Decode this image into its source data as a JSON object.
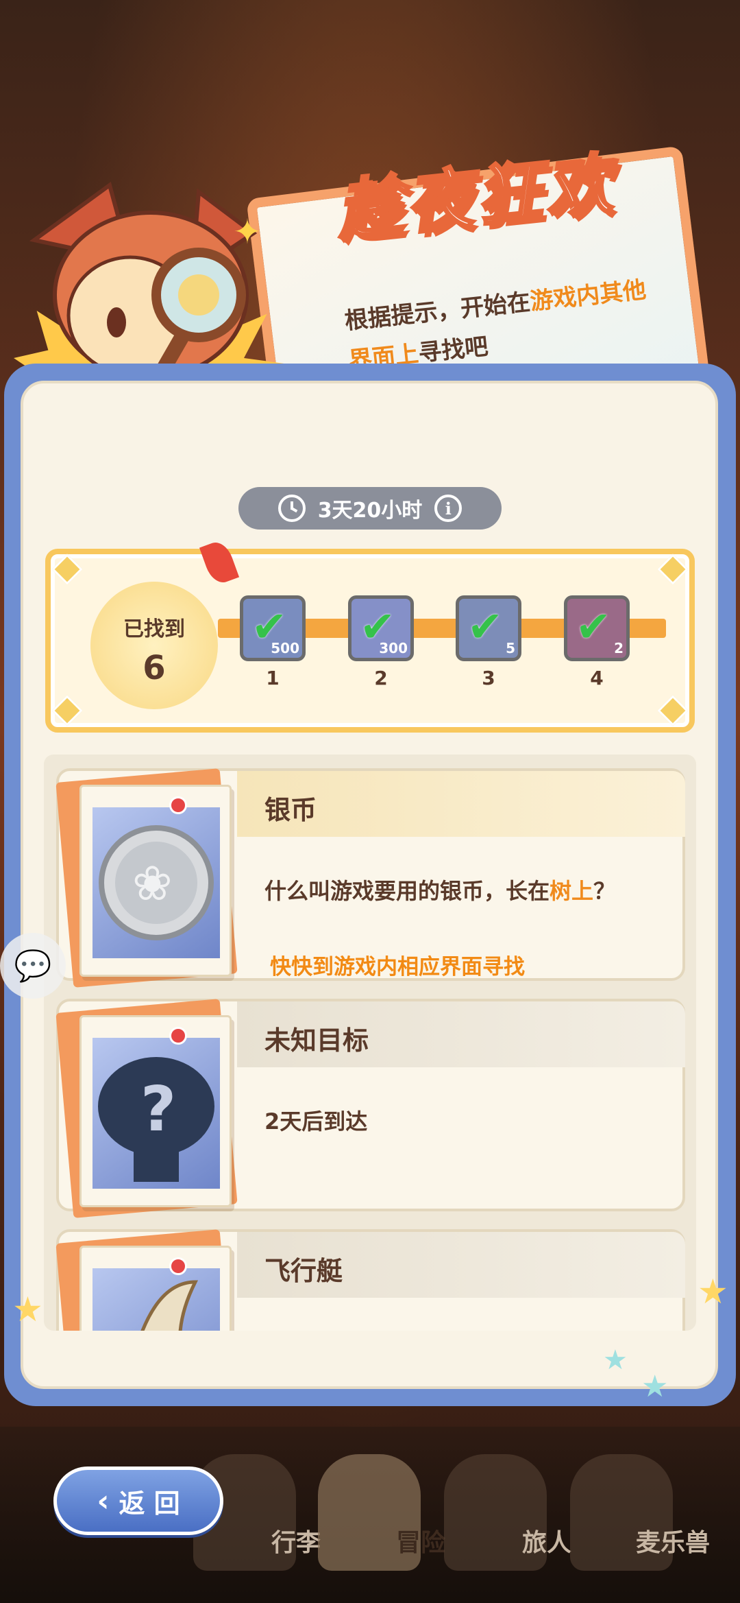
{
  "event": {
    "title": "趁夜狂欢",
    "subtitle_plain": "根据提示，开始在",
    "subtitle_highlight1": "游戏内其他界面上",
    "subtitle_end": "寻找吧"
  },
  "timer": {
    "text": "3天20小时",
    "icon": "clock-icon",
    "info_icon": "info-icon"
  },
  "progress": {
    "found_label": "已找到",
    "found_count": "6",
    "milestones": [
      {
        "index": "1",
        "count": "500",
        "claimed": true
      },
      {
        "index": "2",
        "count": "300",
        "claimed": true
      },
      {
        "index": "3",
        "count": "5",
        "claimed": true
      },
      {
        "index": "4",
        "count": "2",
        "claimed": true
      }
    ]
  },
  "items": [
    {
      "name": "银币",
      "desc_plain": "什么叫游戏要用的银币，长在",
      "desc_highlight": "树上",
      "desc_end": "？",
      "hint": "快快到游戏内相应界面寻找"
    },
    {
      "name": "未知目标",
      "desc_plain": "2天后到达"
    },
    {
      "name": "飞行艇"
    }
  ],
  "nav": {
    "back_label": "返 回",
    "tabs": [
      "行李",
      "冒险",
      "旅人",
      "麦乐兽"
    ]
  },
  "colors": {
    "accent": "#f08a1c",
    "panel": "#6f8ed1",
    "check": "#35c24a"
  }
}
